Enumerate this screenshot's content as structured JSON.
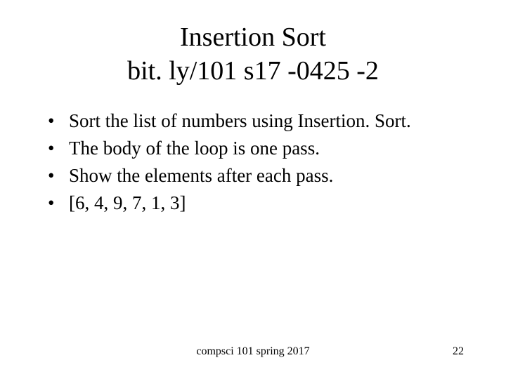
{
  "title": {
    "line1": "Insertion Sort",
    "line2": "bit. ly/101 s17 -0425 -2"
  },
  "bullets": [
    "Sort the list of numbers using Insertion. Sort.",
    "The body of the loop is one pass.",
    "Show the elements after each pass.",
    "[6, 4, 9, 7, 1, 3]"
  ],
  "footer": {
    "center": "compsci 101 spring 2017",
    "page": "22"
  }
}
